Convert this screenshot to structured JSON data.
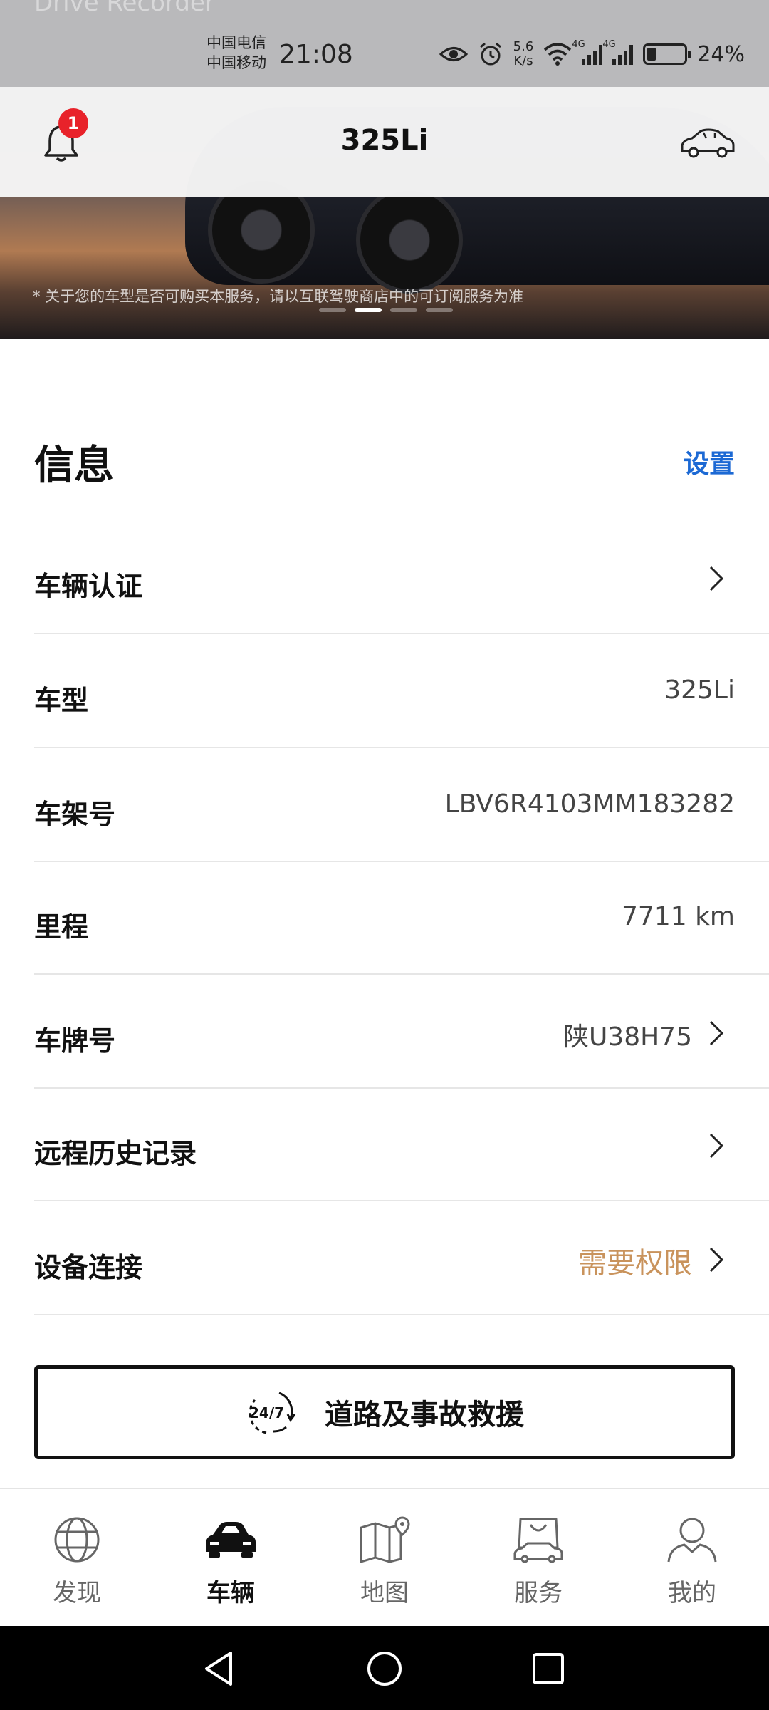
{
  "status_bar": {
    "carrier_1": "中国电信",
    "carrier_2": "中国移动",
    "time": "21:08",
    "net_speed_value": "5.6",
    "net_speed_unit": "K/s",
    "network_1": "4G",
    "network_2": "4G",
    "battery_percent": "24%",
    "battery_level": 0.24
  },
  "hero": {
    "ghost_title": "Drive Recorder",
    "disclaimer": "* 关于您的车型是否可购买本服务，请以互联驾驶商店中的可订阅服务为准",
    "carousel_count": 4,
    "carousel_active_index": 1
  },
  "header": {
    "title": "325Li",
    "notification_count": "1"
  },
  "info": {
    "title": "信息",
    "settings_label": "设置",
    "rows": [
      {
        "label": "车辆认证",
        "value": ""
      },
      {
        "label": "车型",
        "value": "325Li"
      },
      {
        "label": "车架号",
        "value": "LBV6R4103MM183282"
      },
      {
        "label": "里程",
        "value": "7711 km"
      },
      {
        "label": "车牌号",
        "value": "陕U38H75"
      },
      {
        "label": "远程历史记录",
        "value": ""
      },
      {
        "label": "设备连接",
        "value": "需要权限"
      }
    ]
  },
  "rescue": {
    "icon_text": "24/7",
    "label": "道路及事故救援"
  },
  "bottom_nav": [
    {
      "label": "发现",
      "icon": "globe-icon",
      "active": false
    },
    {
      "label": "车辆",
      "icon": "car-icon",
      "active": true
    },
    {
      "label": "地图",
      "icon": "map-icon",
      "active": false
    },
    {
      "label": "服务",
      "icon": "shopping-bag-icon",
      "active": false
    },
    {
      "label": "我的",
      "icon": "user-icon",
      "active": false
    }
  ],
  "colors": {
    "accent_blue": "#1c69d4",
    "warning_gold": "#c9935c",
    "badge_red": "#e8222a"
  }
}
